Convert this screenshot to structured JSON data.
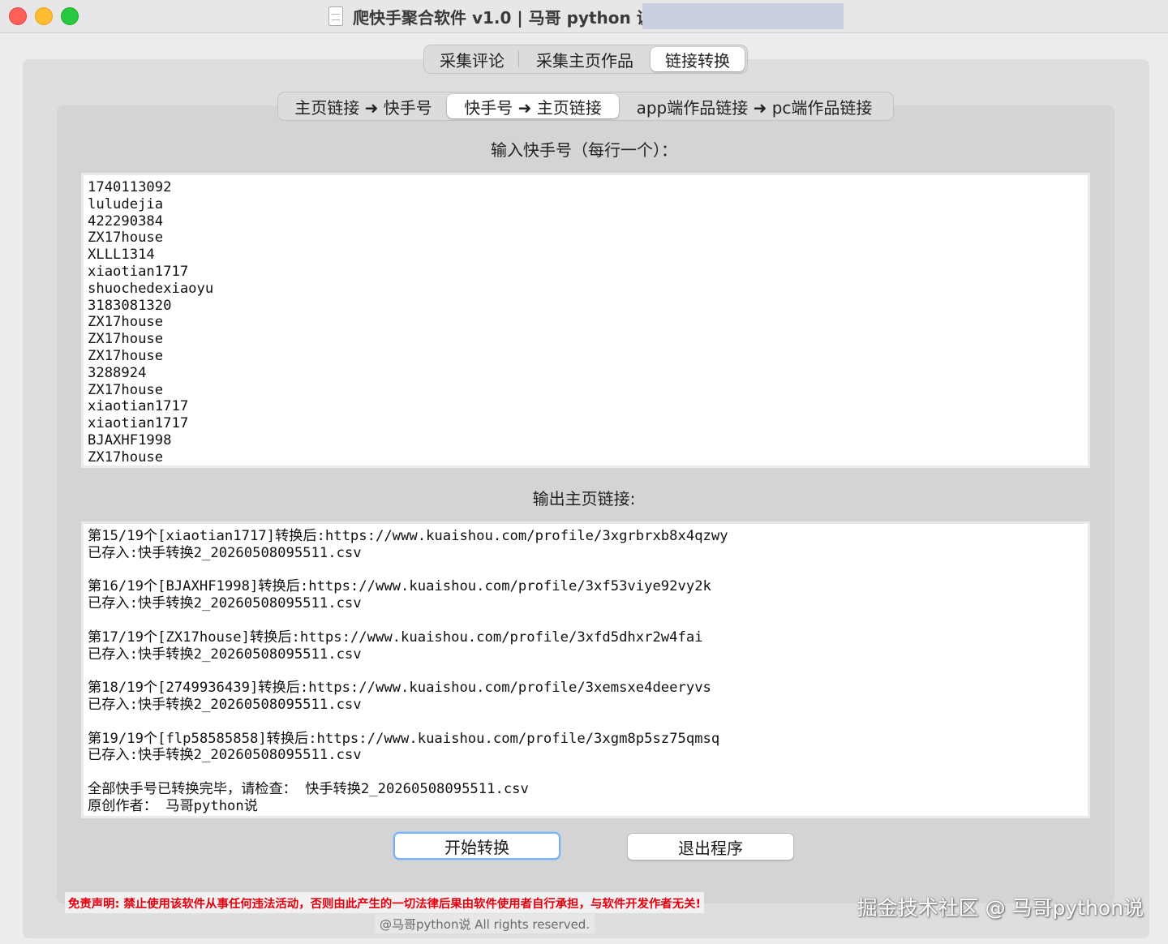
{
  "window": {
    "title": "爬快手聚合软件 v1.0 | 马哥 python 说 |"
  },
  "tabs_main": [
    {
      "label": "采集评论",
      "active": false
    },
    {
      "label": "采集主页作品",
      "active": false
    },
    {
      "label": "链接转换",
      "active": true
    }
  ],
  "tabs_sub": [
    {
      "label": "主页链接 ➜ 快手号",
      "active": false
    },
    {
      "label": "快手号 ➜ 主页链接",
      "active": true
    },
    {
      "label": "app端作品链接 ➜ pc端作品链接",
      "active": false
    }
  ],
  "input": {
    "label": "输入快手号（每行一个）：",
    "lines": [
      "1740113092",
      "luludejia",
      "422290384",
      "ZX17house",
      "XLLL1314",
      "xiaotian1717",
      "shuochedexiaoyu",
      "3183081320",
      "ZX17house",
      "ZX17house",
      "ZX17house",
      "3288924",
      "ZX17house",
      "xiaotian1717",
      "xiaotian1717",
      "BJAXHF1998",
      "ZX17house"
    ]
  },
  "output": {
    "label": "输出主页链接:",
    "lines": [
      "第15/19个[xiaotian1717]转换后:https://www.kuaishou.com/profile/3xgrbrxb8x4qzwy",
      "已存入:快手转换2_20260508095511.csv",
      "",
      "第16/19个[BJAXHF1998]转换后:https://www.kuaishou.com/profile/3xf53viye92vy2k",
      "已存入:快手转换2_20260508095511.csv",
      "",
      "第17/19个[ZX17house]转换后:https://www.kuaishou.com/profile/3xfd5dhxr2w4fai",
      "已存入:快手转换2_20260508095511.csv",
      "",
      "第18/19个[2749936439]转换后:https://www.kuaishou.com/profile/3xemsxe4deeryvs",
      "已存入:快手转换2_20260508095511.csv",
      "",
      "第19/19个[flp58585858]转换后:https://www.kuaishou.com/profile/3xgm8p5sz75qmsq",
      "已存入:快手转换2_20260508095511.csv",
      "",
      "全部快手号已转换完毕，请检查： 快手转换2_20260508095511.csv",
      "原创作者： 马哥python说"
    ]
  },
  "buttons": {
    "start": "开始转换",
    "exit": "退出程序"
  },
  "footer": {
    "disclaimer": "免责声明: 禁止使用该软件从事任何违法活动，否则由此产生的一切法律后果由软件使用者自行承担，与软件开发作者无关!",
    "copyright": "@马哥python说 All rights reserved."
  },
  "watermark": "掘金技术社区 @ 马哥python说",
  "colors": {
    "disclaimer_red": "#e3000f",
    "focus_blue": "#7fb1ef",
    "close": "#fe5f57",
    "minimize": "#febc2e",
    "zoom": "#28c840"
  }
}
